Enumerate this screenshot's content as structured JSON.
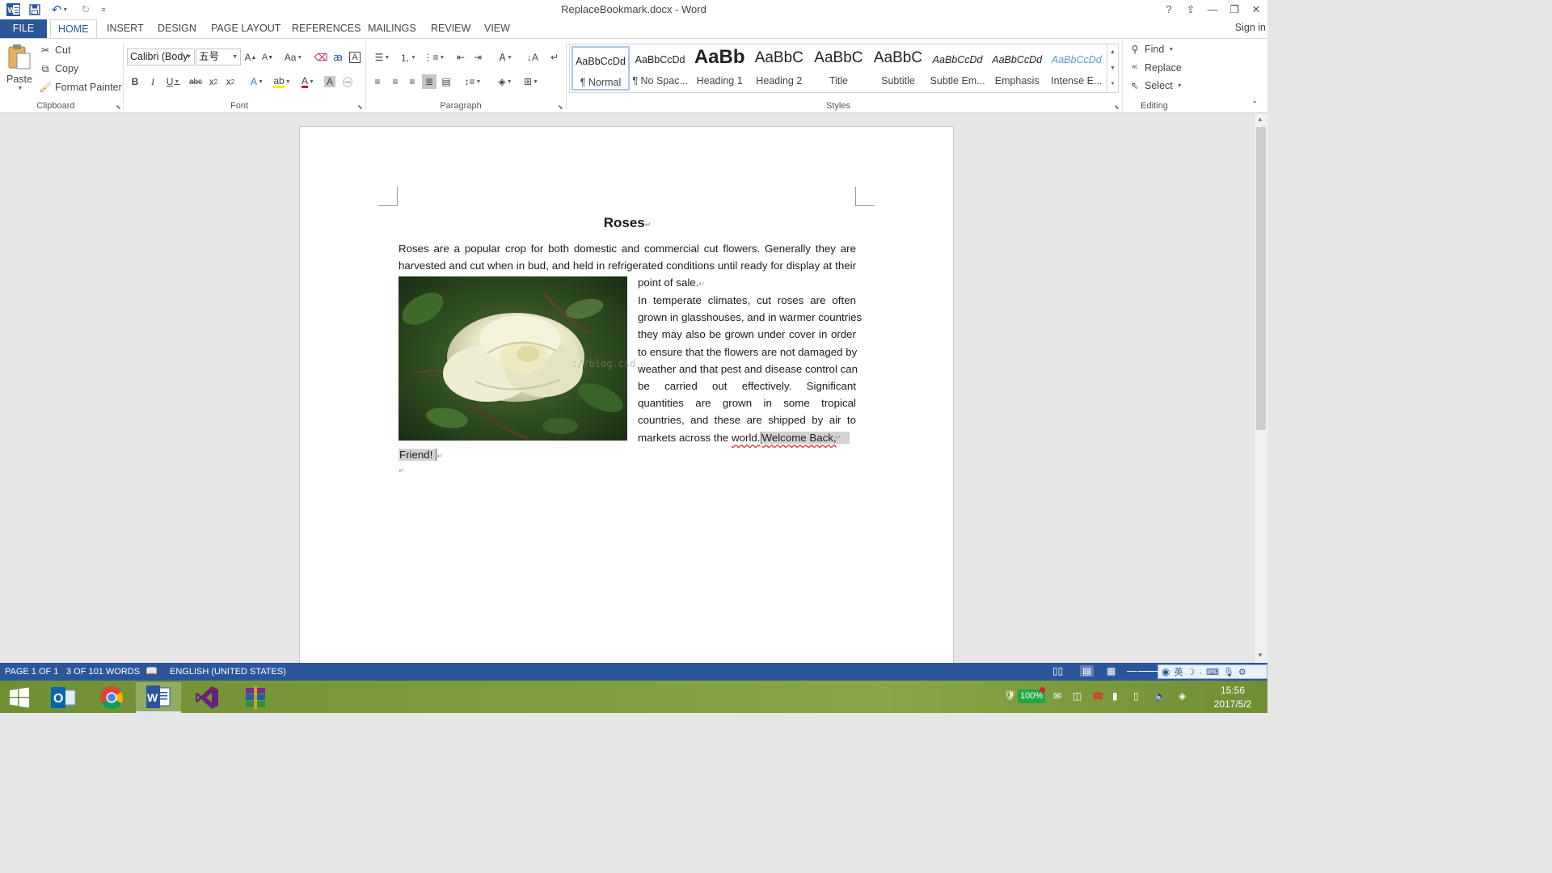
{
  "window": {
    "title": "ReplaceBookmark.docx - Word",
    "help": "?",
    "ribbon_display": "⇪",
    "minimize": "—",
    "restore": "❐",
    "close": "✕"
  },
  "tabs": {
    "file": "FILE",
    "home": "HOME",
    "insert": "INSERT",
    "design": "DESIGN",
    "page_layout": "PAGE LAYOUT",
    "references": "REFERENCES",
    "mailings": "MAILINGS",
    "review": "REVIEW",
    "view": "VIEW",
    "sign_in": "Sign in"
  },
  "clipboard": {
    "paste": "Paste",
    "cut": "Cut",
    "copy": "Copy",
    "format_painter": "Format Painter",
    "label": "Clipboard"
  },
  "font": {
    "name": "Calibri (Body",
    "size": "五号",
    "label": "Font"
  },
  "paragraph": {
    "label": "Paragraph"
  },
  "styles": {
    "label": "Styles",
    "items": [
      {
        "preview": "AaBbCcDd",
        "name": "¶ Normal"
      },
      {
        "preview": "AaBbCcDd",
        "name": "¶ No Spac..."
      },
      {
        "preview": "AaBb",
        "name": "Heading 1"
      },
      {
        "preview": "AaBbC",
        "name": "Heading 2"
      },
      {
        "preview": "AaBbC",
        "name": "Title"
      },
      {
        "preview": "AaBbC",
        "name": "Subtitle"
      },
      {
        "preview": "AaBbCcDd",
        "name": "Subtle Em..."
      },
      {
        "preview": "AaBbCcDd",
        "name": "Emphasis"
      },
      {
        "preview": "AaBbCcDd",
        "name": "Intense E..."
      }
    ]
  },
  "editing": {
    "find": "Find",
    "replace": "Replace",
    "select": "Select",
    "label": "Editing"
  },
  "document": {
    "title": "Roses",
    "p1_lines": [
      "Roses are a popular crop for both domestic and commercial cut flowers. Generally they are",
      "harvested and cut when in bud, and held in refrigerated conditions until ready for display at their"
    ],
    "p1_last": "point of sale.",
    "p2_lines": [
      "In temperate climates, cut roses are often",
      "grown in glasshouses, and in warmer countries",
      "they may also be grown under cover in order",
      "to ensure that the flowers are not damaged by",
      "weather and that pest and disease control can",
      "be carried out effectively. Significant",
      "quantities are grown in some tropical",
      "countries, and these are shipped by air to"
    ],
    "p2_last_prefix": "markets across the ",
    "p2_last_word": "world.",
    "bookmark_part1": "Welcome Back,",
    "bookmark_part2": "Friend!",
    "watermark": "://blog.csd"
  },
  "status": {
    "page": "PAGE 1 OF 1",
    "words": "3 OF 101 WORDS",
    "language": "ENGLISH (UNITED STATES)"
  },
  "taskbar": {
    "battery": "100%",
    "time": "15:56",
    "date": "2017/5/2",
    "ime": "英"
  }
}
